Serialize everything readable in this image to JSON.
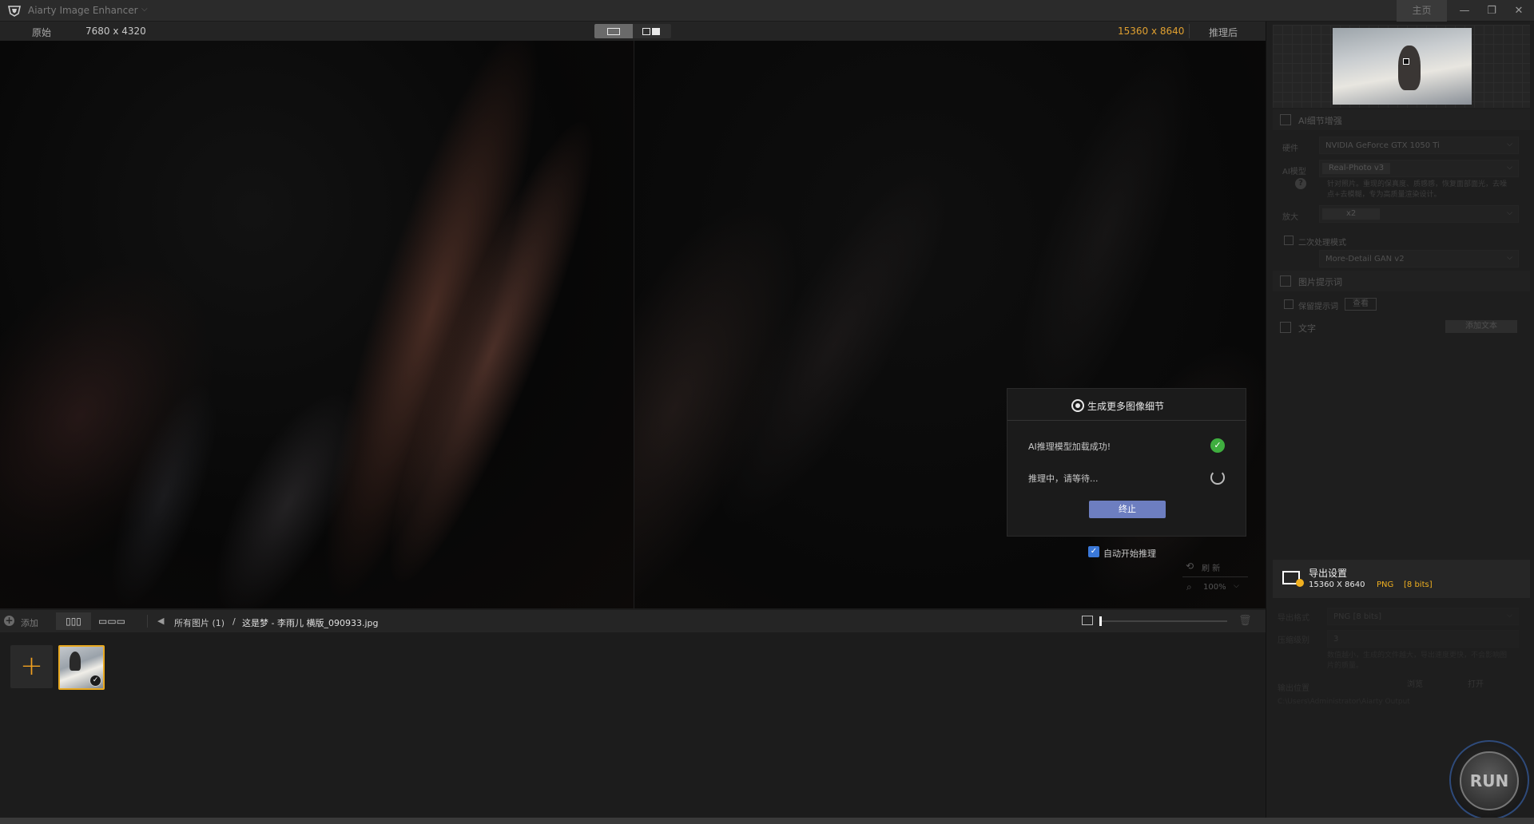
{
  "app": {
    "title": "Aiarty Image Enhancer",
    "home_tab": "主页",
    "window_controls": {
      "minimize": "—",
      "restore": "❐",
      "close": "✕"
    }
  },
  "compare": {
    "left_label": "原始",
    "left_size": "7680 x 4320",
    "right_size": "15360 x 8640",
    "right_label": "推理后"
  },
  "dialog": {
    "title": "生成更多图像细节",
    "row1": "AI推理模型加载成功!",
    "row2": "推理中，请等待...",
    "stop_label": "终止",
    "auto_start_label": "自动开始推理",
    "auto_start_checked": true
  },
  "viewer_controls": {
    "refresh_label": "刷 新",
    "zoom": "100%"
  },
  "gallery_bar": {
    "add_label": "添加",
    "grid_icon": "▯▯▯",
    "list_icon": "▭▭▭",
    "all_images": "所有图片 (1)",
    "separator": "/",
    "file_name": "这是梦 - 李雨儿 横版_090933.jpg"
  },
  "panel": {
    "ai_detail_title": "AI细节增强",
    "hardware_label": "硬件",
    "hardware_value": "NVIDIA GeForce GTX 1050 Ti",
    "model_label": "AI模型",
    "model_value": "Real-Photo v3",
    "model_hint": "针对照片。重现的保真度、质感感，恢复面部面光，去噪点+去模糊，专为高质量渲染设计。",
    "scale_label": "放大",
    "scale_value": "x2",
    "second_pass_label": "二次处理模式",
    "second_model_value": "More-Detail GAN v2",
    "prompt_section": "图片提示词",
    "keep_prompt_label": "保留提示词",
    "view_button": "查看",
    "text_section": "文字",
    "add_text_button": "添加文本"
  },
  "export": {
    "title": "导出设置",
    "dimensions": "15360 X 8640",
    "format": "PNG",
    "bits": "[8 bits]",
    "format_label": "导出格式",
    "format_value": "PNG  [8 bits]",
    "quality_label": "压缩级别",
    "quality_value": "3",
    "quality_hint": "数值越小，生成的文件越大，导出速度更快，不会影响图片的质量。",
    "output_label": "输出位置",
    "browse_button": "浏览",
    "open_button": "打开",
    "output_path": "C:\\Users\\Administrator\\Aiarty Output",
    "run_label": "RUN"
  },
  "colors": {
    "accent_orange": "#e0a030",
    "stop_button": "#6d7ec0",
    "success_green": "#3fae3f",
    "check_blue": "#3a78d8"
  }
}
